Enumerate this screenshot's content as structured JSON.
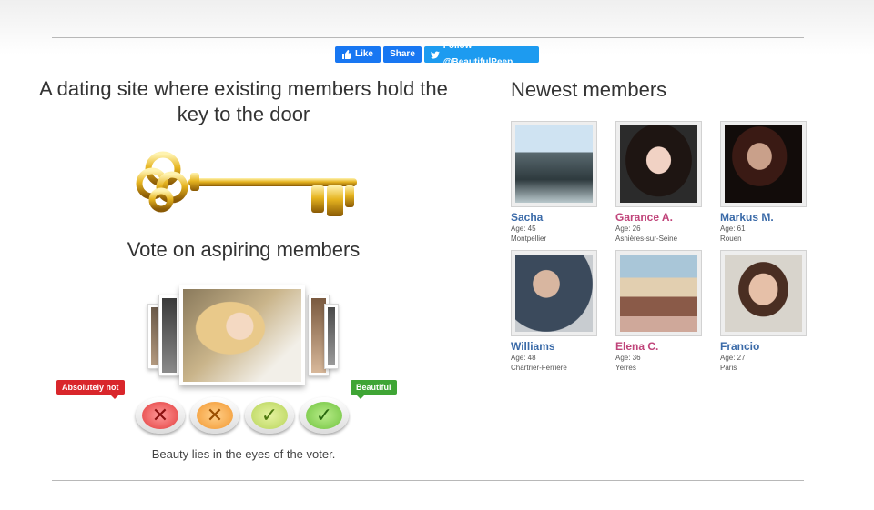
{
  "social": {
    "like_label": "Like",
    "share_label": "Share",
    "follow_label": "Follow @BeautifulPeep"
  },
  "headline": "A dating site where existing members hold the key to the door",
  "vote_title": "Vote on aspiring members",
  "tags": {
    "no": "Absolutely not",
    "yes": "Beautiful"
  },
  "vote_buttons": [
    "✕",
    "✕",
    "✓",
    "✓"
  ],
  "tagline": "Beauty lies in the eyes of the voter.",
  "newest": {
    "title": "Newest members",
    "members": [
      {
        "name": "Sacha",
        "age": "Age: 45",
        "city": "Montpellier"
      },
      {
        "name": "Garance A.",
        "age": "Age: 26",
        "city": "Asnières-sur-Seine"
      },
      {
        "name": "Markus M.",
        "age": "Age: 61",
        "city": "Rouen"
      },
      {
        "name": "Williams",
        "age": "Age: 48",
        "city": "Chartrier-Ferrière"
      },
      {
        "name": "Elena C.",
        "age": "Age: 36",
        "city": "Yerres"
      },
      {
        "name": "Francio",
        "age": "Age: 27",
        "city": "Paris"
      }
    ]
  },
  "colors": {
    "facebook": "#1877f2",
    "twitter": "#1d9bf0",
    "male_name": "#3a6aa8",
    "female_name": "#c0447a",
    "tag_no": "#d9262b",
    "tag_yes": "#3fa535"
  }
}
